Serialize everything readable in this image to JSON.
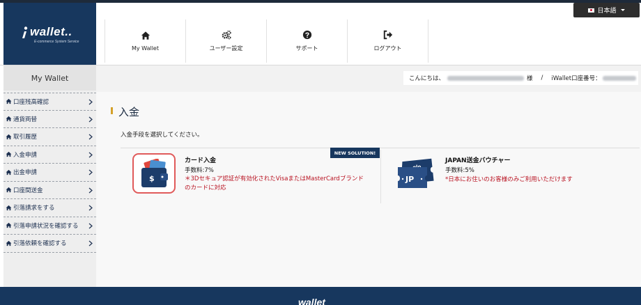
{
  "brand": {
    "name": "wallet..",
    "tagline": "E-commerce System Service"
  },
  "language": {
    "selected": "日本語"
  },
  "nav": {
    "items": [
      {
        "label": "My Wallet",
        "icon": "home-icon"
      },
      {
        "label": "ユーザー設定",
        "icon": "gears-icon"
      },
      {
        "label": "サポート",
        "icon": "question-icon"
      },
      {
        "label": "ログアウト",
        "icon": "sign-out-icon"
      }
    ]
  },
  "sidebar": {
    "title": "My Wallet",
    "items": [
      {
        "label": "口座残高確認"
      },
      {
        "label": "通貨両替"
      },
      {
        "label": "取引履歴"
      },
      {
        "label": "入金申請"
      },
      {
        "label": "出金申請"
      },
      {
        "label": "口座間送金"
      },
      {
        "label": "引落請求をする"
      },
      {
        "label": "引落申請状況を確認する"
      },
      {
        "label": "引落依頼を確認する"
      }
    ]
  },
  "greeting": {
    "prefix": "こんにちは、",
    "honorific": "様",
    "separator": "/",
    "account_label": "iWallet口座番号："
  },
  "main": {
    "title": "入金",
    "instruction": "入金手段を選択してください。",
    "badge": "NEW SOLUTION!",
    "methods": [
      {
        "title": "カード入金",
        "fee": "手数料:7%",
        "note": "＊3Dセキュア認証が有効化されたVisaまたはMasterCardブランドのカードに対応"
      },
      {
        "title": "JAPAN送金バウチャー",
        "fee": "手数料:5%",
        "note": "*日本にお住いのお客様のみご利用いただけます"
      }
    ]
  },
  "footer": {
    "logo": "wallet"
  },
  "colors": {
    "brand_navy": "#17375e",
    "note_red": "#b8101f",
    "highlight_border": "#e05a5a",
    "title_accent": "#d4a12a"
  }
}
